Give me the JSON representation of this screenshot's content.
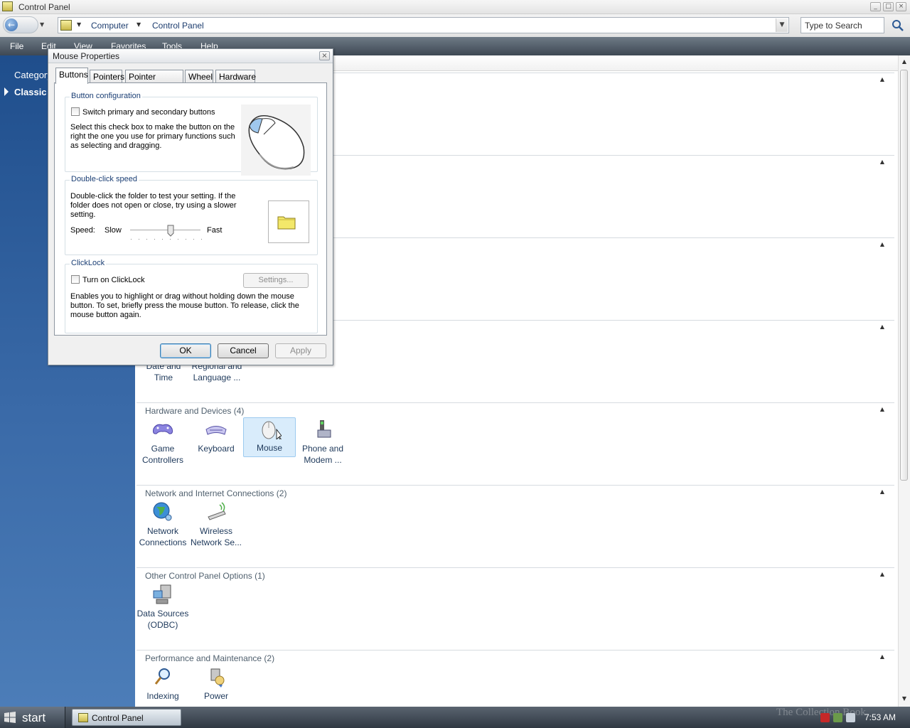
{
  "window": {
    "title": "Control Panel",
    "controls": [
      "_",
      "□",
      "×"
    ]
  },
  "address": {
    "crumbs": [
      "Computer",
      "Control Panel"
    ],
    "search_placeholder": "Type to Search"
  },
  "menu": [
    "File",
    "Edit",
    "View",
    "Favorites",
    "Tools",
    "Help"
  ],
  "sidebar": {
    "items": [
      {
        "label": "Category View"
      },
      {
        "label": "Classic View"
      }
    ],
    "visible_items": [
      "Category",
      "Classic"
    ]
  },
  "content": {
    "groups": [
      {
        "title": "",
        "items": []
      },
      {
        "title": "",
        "items": []
      },
      {
        "title": "",
        "items": []
      },
      {
        "title": "",
        "items": [
          {
            "line1": "Date and",
            "line2": "Time",
            "icon": "clock-icon"
          },
          {
            "line1": "Regional and",
            "line2": "Language ...",
            "icon": "globe-icon"
          }
        ]
      },
      {
        "title": "Hardware and Devices (4)",
        "items": [
          {
            "line1": "Game",
            "line2": "Controllers",
            "icon": "gamepad-icon"
          },
          {
            "line1": "Keyboard",
            "line2": "",
            "icon": "keyboard-icon"
          },
          {
            "line1": "Mouse",
            "line2": "",
            "icon": "mouse-icon",
            "selected": true
          },
          {
            "line1": "Phone and",
            "line2": "Modem ...",
            "icon": "phone-icon"
          }
        ]
      },
      {
        "title": "Network and Internet Connections (2)",
        "items": [
          {
            "line1": "Network",
            "line2": "Connections",
            "icon": "network-globe-icon"
          },
          {
            "line1": "Wireless",
            "line2": "Network Se...",
            "icon": "wireless-icon"
          }
        ]
      },
      {
        "title": "Other Control Panel Options (1)",
        "items": [
          {
            "line1": "Data Sources",
            "line2": "(ODBC)",
            "icon": "database-icon"
          }
        ]
      },
      {
        "title": "Performance and Maintenance (2)",
        "items": [
          {
            "line1": "Indexing",
            "line2": "",
            "icon": "magnifier-icon"
          },
          {
            "line1": "Power",
            "line2": "",
            "icon": "power-icon"
          }
        ]
      }
    ]
  },
  "dialog": {
    "title": "Mouse Properties",
    "tabs": [
      "Buttons",
      "Pointers",
      "Pointer Options",
      "Wheel",
      "Hardware"
    ],
    "active_tab": "Buttons",
    "button_config": {
      "legend": "Button configuration",
      "checkbox_label": "Switch primary and secondary buttons",
      "checked": false,
      "desc1": "Select this check box to make the button on the",
      "desc2": "right the one you use for primary functions such",
      "desc3": "as selecting and dragging."
    },
    "double_click": {
      "legend": "Double-click speed",
      "desc1": "Double-click the folder to test your setting. If the",
      "desc2": "folder does not open or close, try using a slower",
      "desc3": "setting.",
      "speed_label": "Speed:",
      "slow_label": "Slow",
      "fast_label": "Fast",
      "speed_level": 0.58
    },
    "clicklock": {
      "legend": "ClickLock",
      "checkbox_label": "Turn on ClickLock",
      "checked": false,
      "settings_label": "Settings...",
      "desc1": "Enables you to highlight or drag without holding down the mouse",
      "desc2": "button. To set, briefly press the mouse button. To release, click the",
      "desc3": "mouse button again."
    },
    "buttons": {
      "ok": "OK",
      "cancel": "Cancel",
      "apply": "Apply"
    }
  },
  "taskbar": {
    "start_label": "start",
    "task_label": "Control Panel",
    "watermark": "The Collection Book",
    "clock": "7:53 AM"
  },
  "colors": {
    "sidebar_top": "#1f4e8c",
    "menubar": "#4a5561",
    "group_title": "#50606e",
    "item_text": "#1e395b",
    "selection": "#d9ecfb"
  }
}
